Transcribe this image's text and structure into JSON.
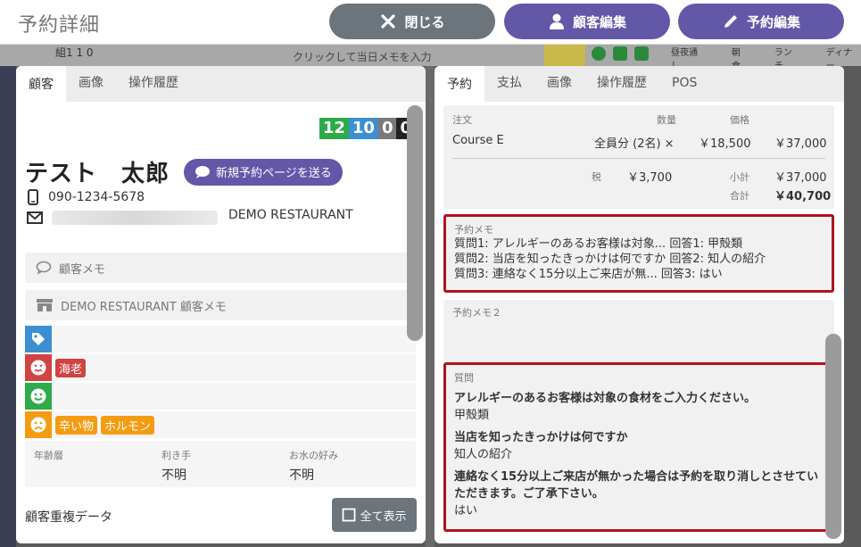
{
  "header": {
    "title": "予約詳細",
    "close_label": "閉じる",
    "customer_edit_label": "顧客編集",
    "reservation_edit_label": "予約編集"
  },
  "background": {
    "info": "組1 1 0",
    "memo_hint": "クリックして当日メモを入力",
    "labels": [
      "昼夜通し",
      "朝食",
      "ランチ",
      "ディナー"
    ]
  },
  "left": {
    "tabs": [
      "顧客",
      "画像",
      "操作履歴"
    ],
    "badges": [
      {
        "value": "12",
        "color": "#2daa4a"
      },
      {
        "value": "10",
        "color": "#3d8fd1"
      },
      {
        "value": "0",
        "color": "#7a7a7a"
      },
      {
        "value": "0",
        "color": "#222222"
      }
    ],
    "customer_name": "テスト　太郎",
    "send_page_label": "新規予約ページを送る",
    "phone": "090-1234-5678",
    "restaurant": "DEMO RESTAURANT",
    "customer_memo_label": "顧客メモ",
    "restaurant_memo_label": "DEMO RESTAURANT 顧客メモ",
    "tag_rows": [
      {
        "icon": "tag-icon",
        "color": "#3d8fd1",
        "chips": []
      },
      {
        "icon": "angry-face-icon",
        "color": "#d14242",
        "chips": [
          {
            "text": "海老",
            "color": "#d14242"
          }
        ]
      },
      {
        "icon": "smile-face-icon",
        "color": "#2daa4a",
        "chips": []
      },
      {
        "icon": "frown-face-icon",
        "color": "#f39c12",
        "chips": [
          {
            "text": "辛い物",
            "color": "#f39c12"
          },
          {
            "text": "ホルモン",
            "color": "#f39c12"
          }
        ]
      }
    ],
    "prefs": [
      {
        "label": "年齢層",
        "value": ""
      },
      {
        "label": "利き手",
        "value": "不明"
      },
      {
        "label": "お水の好み",
        "value": "不明"
      }
    ],
    "duplicate_label": "顧客重複データ",
    "show_all_label": "全て表示"
  },
  "right": {
    "tabs": [
      "予約",
      "支払",
      "画像",
      "操作履歴",
      "POS"
    ],
    "order": {
      "h_item": "注文",
      "h_qty": "数量",
      "h_price": "価格",
      "item": "Course E",
      "qty": "全員分 (2名) ×",
      "price": "￥18,500",
      "total": "￥37,000",
      "tax_label": "税",
      "tax": "￥3,700",
      "subtotal_label": "小計",
      "subtotal": "￥37,000",
      "grand_label": "合計",
      "grand": "￥40,700"
    },
    "memo1_label": "予約メモ",
    "memo1_lines": [
      "質問1: アレルギーのあるお客様は対象... 回答1: 甲殻類",
      "質問2: 当店を知ったきっかけは何ですか 回答2: 知人の紹介",
      "質問3: 連絡なく15分以上ご来店が無... 回答3: はい"
    ],
    "memo2_label": "予約メモ２",
    "questions_label": "質問",
    "questions": [
      {
        "q": "アレルギーのあるお客様は対象の食材をご入力ください。",
        "a": "甲殻類"
      },
      {
        "q": "当店を知ったきっかけは何ですか",
        "a": "知人の紹介"
      },
      {
        "q": "連絡なく15分以上ご来店が無かった場合は予約を取り消しとさせていただきます。ご了承下さい。",
        "a": "はい"
      }
    ]
  }
}
